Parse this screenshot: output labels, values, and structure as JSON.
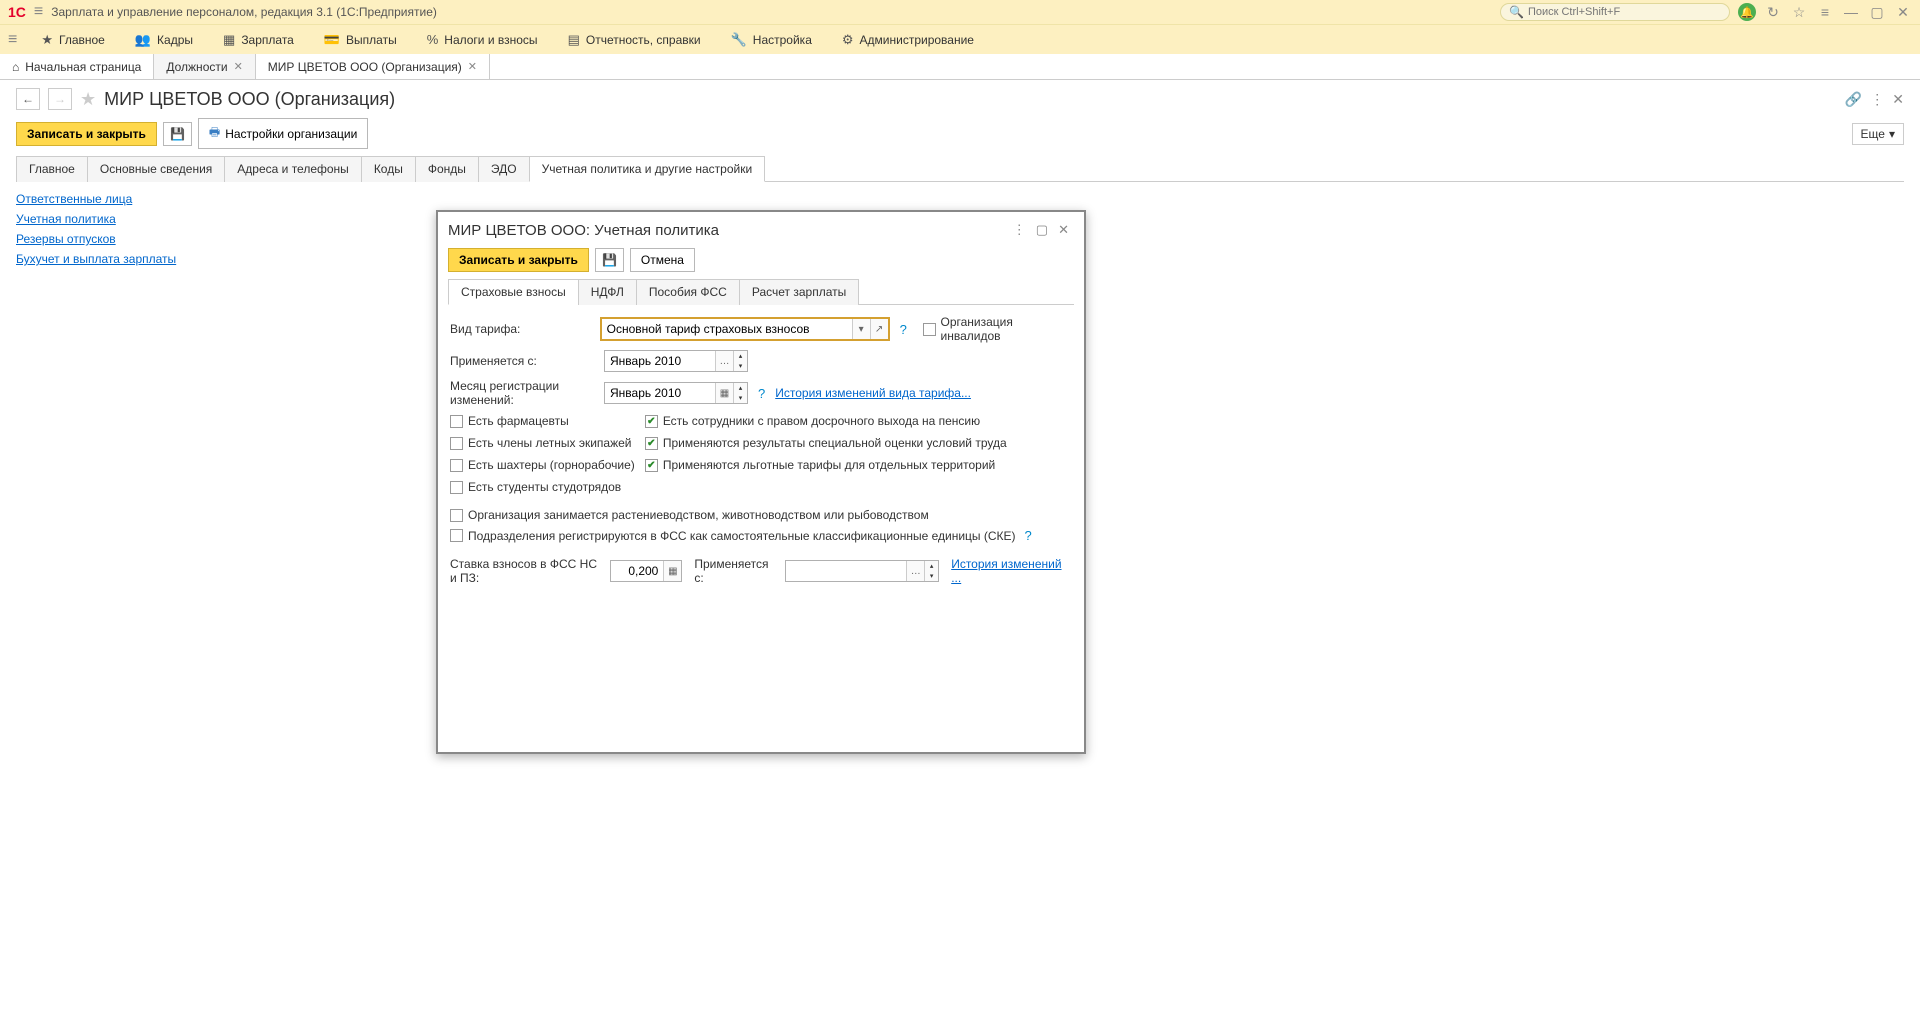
{
  "titlebar": {
    "logo": "1C",
    "app_title": "Зарплата и управление персоналом, редакция 3.1  (1С:Предприятие)",
    "search_placeholder": "Поиск Ctrl+Shift+F"
  },
  "mainmenu": {
    "items": [
      {
        "icon": "★",
        "label": "Главное"
      },
      {
        "icon": "👥",
        "label": "Кадры"
      },
      {
        "icon": "▦",
        "label": "Зарплата"
      },
      {
        "icon": "💳",
        "label": "Выплаты"
      },
      {
        "icon": "%",
        "label": "Налоги и взносы"
      },
      {
        "icon": "▤",
        "label": "Отчетность, справки"
      },
      {
        "icon": "🔧",
        "label": "Настройка"
      },
      {
        "icon": "⚙",
        "label": "Администрирование"
      }
    ]
  },
  "doctabs": {
    "home": "Начальная страница",
    "t1": "Должности",
    "t2": "МИР ЦВЕТОВ ООО (Организация)"
  },
  "page": {
    "title": "МИР ЦВЕТОВ ООО (Организация)",
    "save_close": "Записать и закрыть",
    "org_settings": "Настройки организации",
    "more": "Еще"
  },
  "subtabs": {
    "t0": "Главное",
    "t1": "Основные сведения",
    "t2": "Адреса и телефоны",
    "t3": "Коды",
    "t4": "Фонды",
    "t5": "ЭДО",
    "t6": "Учетная политика и другие настройки"
  },
  "links": {
    "l0": "Ответственные лица",
    "l1": "Учетная политика",
    "l2": "Резервы отпусков",
    "l3": "Бухучет и выплата зарплаты"
  },
  "dialog": {
    "title": "МИР ЦВЕТОВ ООО: Учетная политика",
    "save_close": "Записать и закрыть",
    "cancel": "Отмена",
    "tabs": {
      "t0": "Страховые взносы",
      "t1": "НДФЛ",
      "t2": "Пособия ФСС",
      "t3": "Расчет зарплаты"
    },
    "form": {
      "tariff_label": "Вид тарифа:",
      "tariff_value": "Основной тариф страховых взносов",
      "org_invalid": "Организация инвалидов",
      "applies_from_label": "Применяется с:",
      "applies_from_value": "Январь 2010",
      "reg_month_label": "Месяц регистрации изменений:",
      "reg_month_value": "Январь 2010",
      "history_tariff": "История изменений вида тарифа...",
      "chk_pharm": "Есть фармацевты",
      "chk_flight": "Есть члены летных экипажей",
      "chk_miners": "Есть шахтеры (горнорабочие)",
      "chk_students": "Есть студенты студотрядов",
      "chk_pension": "Есть сотрудники с правом досрочного выхода на пенсию",
      "chk_special": "Применяются результаты специальной оценки условий труда",
      "chk_territory": "Применяются льготные тарифы для отдельных территорий",
      "chk_agri": "Организация занимается растениеводством, животноводством или рыбоводством",
      "chk_fss_units": "Подразделения регистрируются в ФСС как самостоятельные классификационные единицы (СКЕ)",
      "fss_rate_label": "Ставка взносов в ФСС НС и ПЗ:",
      "fss_rate_value": "0,200",
      "fss_applies_label": "Применяется с:",
      "fss_history": "История изменений ..."
    }
  }
}
